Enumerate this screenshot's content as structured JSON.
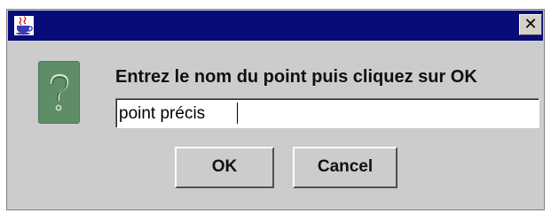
{
  "window": {
    "titlebar_color": "#070c78",
    "title_icon": "java-coffee-cup-icon",
    "close_label": "✕"
  },
  "content": {
    "icon": "question-mark-icon",
    "prompt": "Entrez le nom du point puis cliquez sur OK",
    "input_value": "point précis"
  },
  "buttons": {
    "ok_label": "OK",
    "cancel_label": "Cancel"
  }
}
